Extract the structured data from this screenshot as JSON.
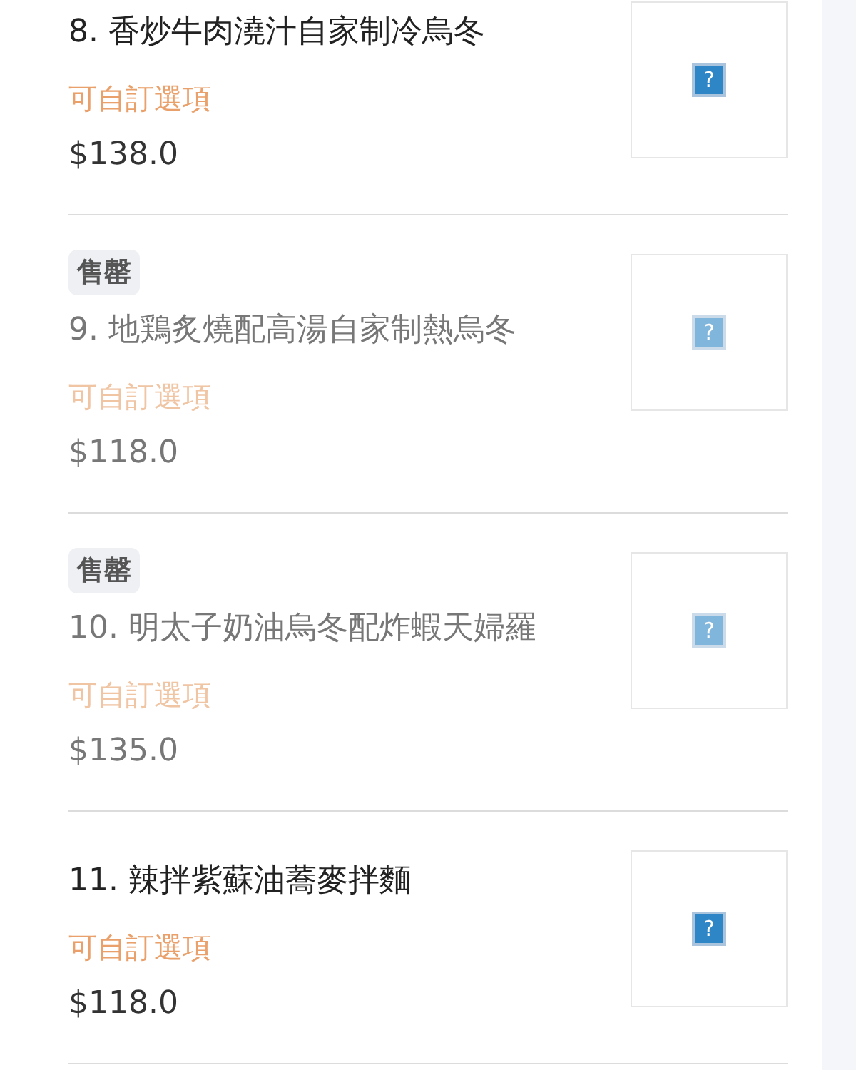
{
  "menu_items": [
    {
      "title": "8. 香炒牛肉澆汁自家制冷烏冬",
      "options": "可自訂選項",
      "price": "$138.0",
      "sold_out": false,
      "image_icon": "?"
    },
    {
      "badge": "售罄",
      "title": "9. 地鶏炙燒配高湯自家制熱烏冬",
      "options": "可自訂選項",
      "price": "$118.0",
      "sold_out": true,
      "image_icon": "?"
    },
    {
      "badge": "售罄",
      "title": "10. 明太子奶油烏冬配炸蝦天婦羅",
      "options": "可自訂選項",
      "price": "$135.0",
      "sold_out": true,
      "image_icon": "?"
    },
    {
      "title": "11. 辣拌紫蘇油蕎麥拌麵",
      "options": "可自訂選項",
      "price": "$118.0",
      "sold_out": false,
      "image_icon": "?"
    }
  ]
}
